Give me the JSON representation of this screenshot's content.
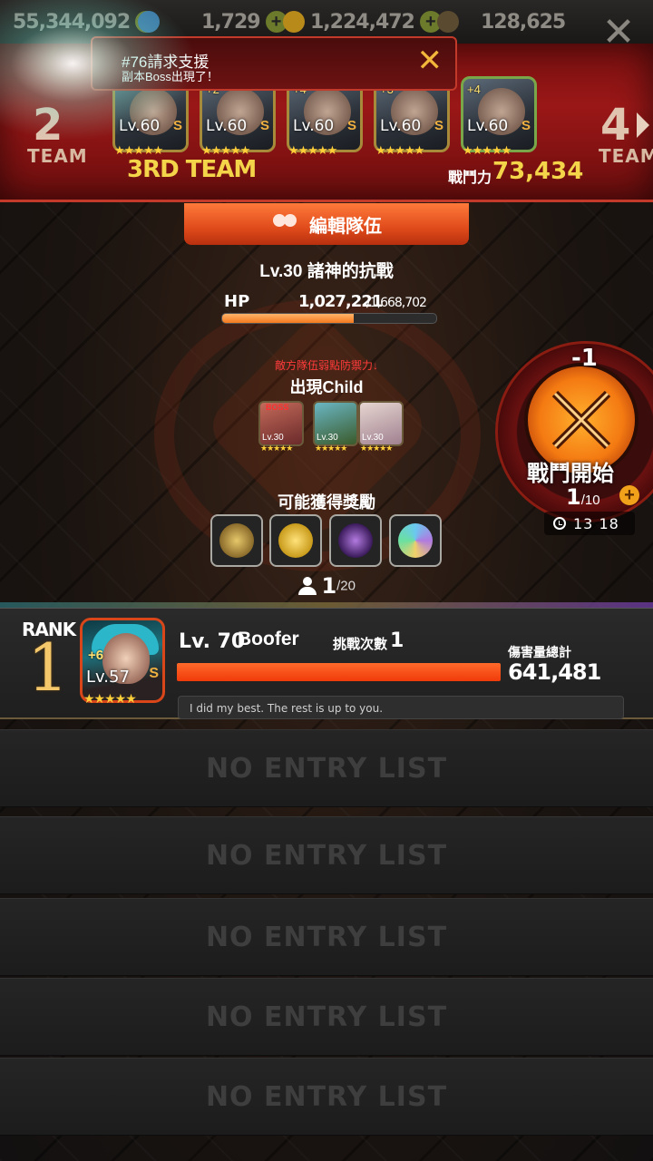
{
  "resources": [
    {
      "icon": "gem-icon",
      "value": "55,344,092"
    },
    {
      "icon": "crystal-icon",
      "value": "1,729"
    },
    {
      "icon": "gold-coin-icon",
      "value": "1,224,472"
    },
    {
      "icon": "soul-icon",
      "value": "128,625"
    }
  ],
  "notice": {
    "line1": "#76請求支援",
    "line2": "副本Boss出現了！"
  },
  "team": {
    "prev_number": "2",
    "prev_label": "TEAM",
    "next_number": "4",
    "next_label": "TEAM",
    "current_label": "3RD TEAM",
    "power_label": "戰鬥力",
    "power_value": "73,434",
    "heroes": [
      {
        "plus": "",
        "level": "Lv.60",
        "rank": "S",
        "stars": "★★★★★"
      },
      {
        "plus": "+2",
        "level": "Lv.60",
        "rank": "S",
        "stars": "★★★★★"
      },
      {
        "plus": "+4",
        "level": "Lv.60",
        "rank": "S",
        "stars": "★★★★★"
      },
      {
        "plus": "+3",
        "level": "Lv.60",
        "rank": "S",
        "stars": "★★★★★"
      },
      {
        "plus": "+4",
        "level": "Lv.60",
        "rank": "S",
        "stars": "★★★★★"
      }
    ]
  },
  "edit_team_label": "編輯隊伍",
  "boss": {
    "title": "Lv.30 諸神的抗戰",
    "hp_label": "HP",
    "hp_current": "1,027,221",
    "hp_max": "/1,668,702",
    "hp_ratio": 0.6156
  },
  "weak_note": "敵方隊伍弱點防禦力↓",
  "child_title": "出現Child",
  "enemies": [
    {
      "boss_tag": "BOSS",
      "level": "Lv.30",
      "stars": "★★★★★"
    },
    {
      "boss_tag": "",
      "level": "Lv.30",
      "stars": "★★★★★"
    },
    {
      "boss_tag": "",
      "level": "Lv.30",
      "stars": "★★★★★"
    }
  ],
  "reward_title": "可能獲得獎勵",
  "rewards": [
    "medal-icon",
    "gold-coins-icon",
    "dark-heart-gem-icon",
    "rainbow-crystal-icon"
  ],
  "entries": {
    "current": "1",
    "max": "/20"
  },
  "battle": {
    "cost": "-1",
    "label": "戰鬥開始",
    "stamina_current": "1",
    "stamina_max": "/10",
    "timer": "13 18"
  },
  "leaderboard": {
    "rank_label": "RANK",
    "top": {
      "rank": "1",
      "portrait_plus": "+6",
      "portrait_level": "Lv.57",
      "portrait_rank": "S",
      "stars": "★★★★★",
      "level_label": "Lv. 70",
      "name": "Boofer",
      "tries_label": "挑戰次數",
      "tries": "1",
      "damage_label": "傷害量總計",
      "damage": "641,481",
      "comment": "I did my best. The rest is up to you."
    },
    "empty_label": "NO ENTRY LIST",
    "empty_rows": [
      "NO ENTRY LIST",
      "NO ENTRY LIST",
      "NO ENTRY LIST",
      "NO ENTRY LIST",
      "NO ENTRY LIST"
    ]
  },
  "colors": {
    "accent_orange": "#f47a1e",
    "team_red": "#9a1717",
    "gold_text": "#f4d54a"
  }
}
